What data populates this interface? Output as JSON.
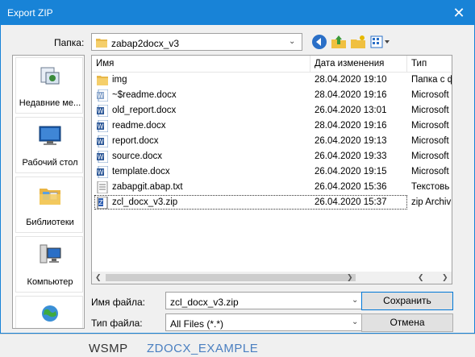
{
  "window": {
    "title": "Export ZIP"
  },
  "folder": {
    "label": "Папка:",
    "current": "zabap2docx_v3"
  },
  "toolbar": {
    "back": "back-icon",
    "up": "up-folder-icon",
    "new_folder": "new-folder-icon",
    "view": "view-menu-icon"
  },
  "places": [
    {
      "label": "Недавние ме...",
      "icon": "recent-places-icon"
    },
    {
      "label": "Рабочий стол",
      "icon": "desktop-icon"
    },
    {
      "label": "Библиотеки",
      "icon": "libraries-icon"
    },
    {
      "label": "Компьютер",
      "icon": "computer-icon"
    },
    {
      "label": "",
      "icon": "network-icon"
    }
  ],
  "columns": {
    "name": "Имя",
    "date": "Дата изменения",
    "type": "Тип"
  },
  "files": [
    {
      "name": "img",
      "date": "28.04.2020 19:10",
      "type": "Папка с ф",
      "icon": "folder-icon"
    },
    {
      "name": "~$readme.docx",
      "date": "28.04.2020 19:16",
      "type": "Microsoft",
      "icon": "word-temp-icon"
    },
    {
      "name": "old_report.docx",
      "date": "26.04.2020 13:01",
      "type": "Microsoft",
      "icon": "word-icon"
    },
    {
      "name": "readme.docx",
      "date": "28.04.2020 19:16",
      "type": "Microsoft",
      "icon": "word-icon"
    },
    {
      "name": "report.docx",
      "date": "26.04.2020 19:13",
      "type": "Microsoft",
      "icon": "word-icon"
    },
    {
      "name": "source.docx",
      "date": "26.04.2020 19:33",
      "type": "Microsoft",
      "icon": "word-icon"
    },
    {
      "name": "template.docx",
      "date": "26.04.2020 19:15",
      "type": "Microsoft",
      "icon": "word-icon"
    },
    {
      "name": "zabapgit.abap.txt",
      "date": "26.04.2020 15:36",
      "type": "Текстовь",
      "icon": "text-file-icon"
    },
    {
      "name": "zcl_docx_v3.zip",
      "date": "26.04.2020 15:37",
      "type": "zip Archiv",
      "icon": "zip-icon",
      "selected": true
    }
  ],
  "filename": {
    "label": "Имя файла:",
    "value": "zcl_docx_v3.zip"
  },
  "filetype": {
    "label": "Тип файла:",
    "value": "All Files (*.*)"
  },
  "buttons": {
    "save": "Сохранить",
    "cancel": "Отмена"
  },
  "background": {
    "left_text": "WSMP",
    "right_text": "ZDOCX_EXAMPLE"
  },
  "colors": {
    "titlebar": "#1883d7",
    "accent": "#0078d7"
  }
}
